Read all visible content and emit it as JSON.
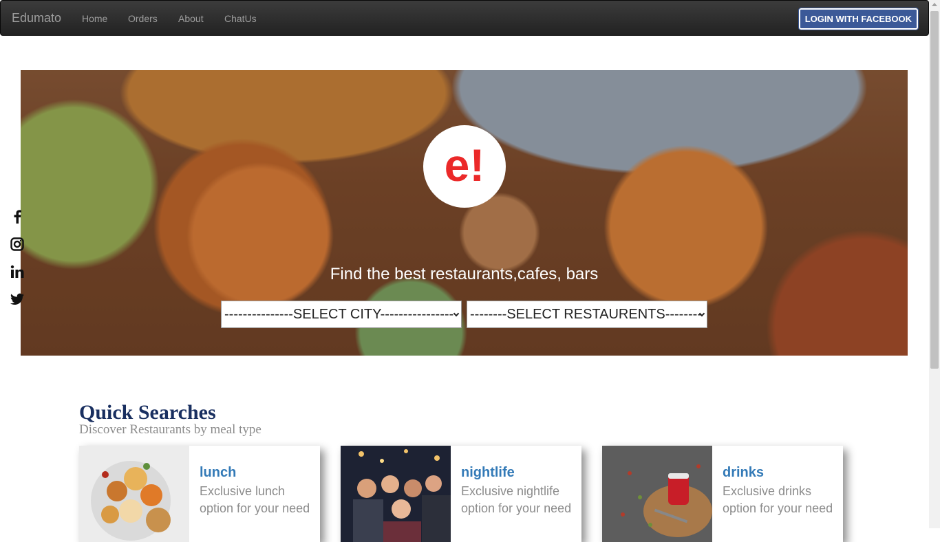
{
  "navbar": {
    "brand": "Edumato",
    "links": [
      "Home",
      "Orders",
      "About",
      "ChatUs"
    ],
    "login_button": "LOGIN WITH FACEBOOK"
  },
  "hero": {
    "logo": "e!",
    "tagline": "Find the best restaurants,cafes, bars",
    "city_select": "---------------SELECT CITY----------------",
    "restaurant_select": "--------SELECT RESTAURENTS--------"
  },
  "social_icons": [
    "facebook-icon",
    "instagram-icon",
    "linkedin-icon",
    "twitter-icon"
  ],
  "quick_searches": {
    "title": "Quick Searches",
    "subtitle": "Discover Restaurants by meal type",
    "cards": [
      {
        "title": "lunch",
        "description": "Exclusive lunch option for your need"
      },
      {
        "title": "nightlife",
        "description": "Exclusive nightlife option for your need"
      },
      {
        "title": "drinks",
        "description": "Exclusive drinks option for your need"
      }
    ]
  },
  "colors": {
    "navbar_bg": "#222222",
    "facebook_blue": "#3b5998",
    "logo_red": "#eb2929",
    "heading_navy": "#192f60",
    "card_title_blue": "#337ab7"
  }
}
